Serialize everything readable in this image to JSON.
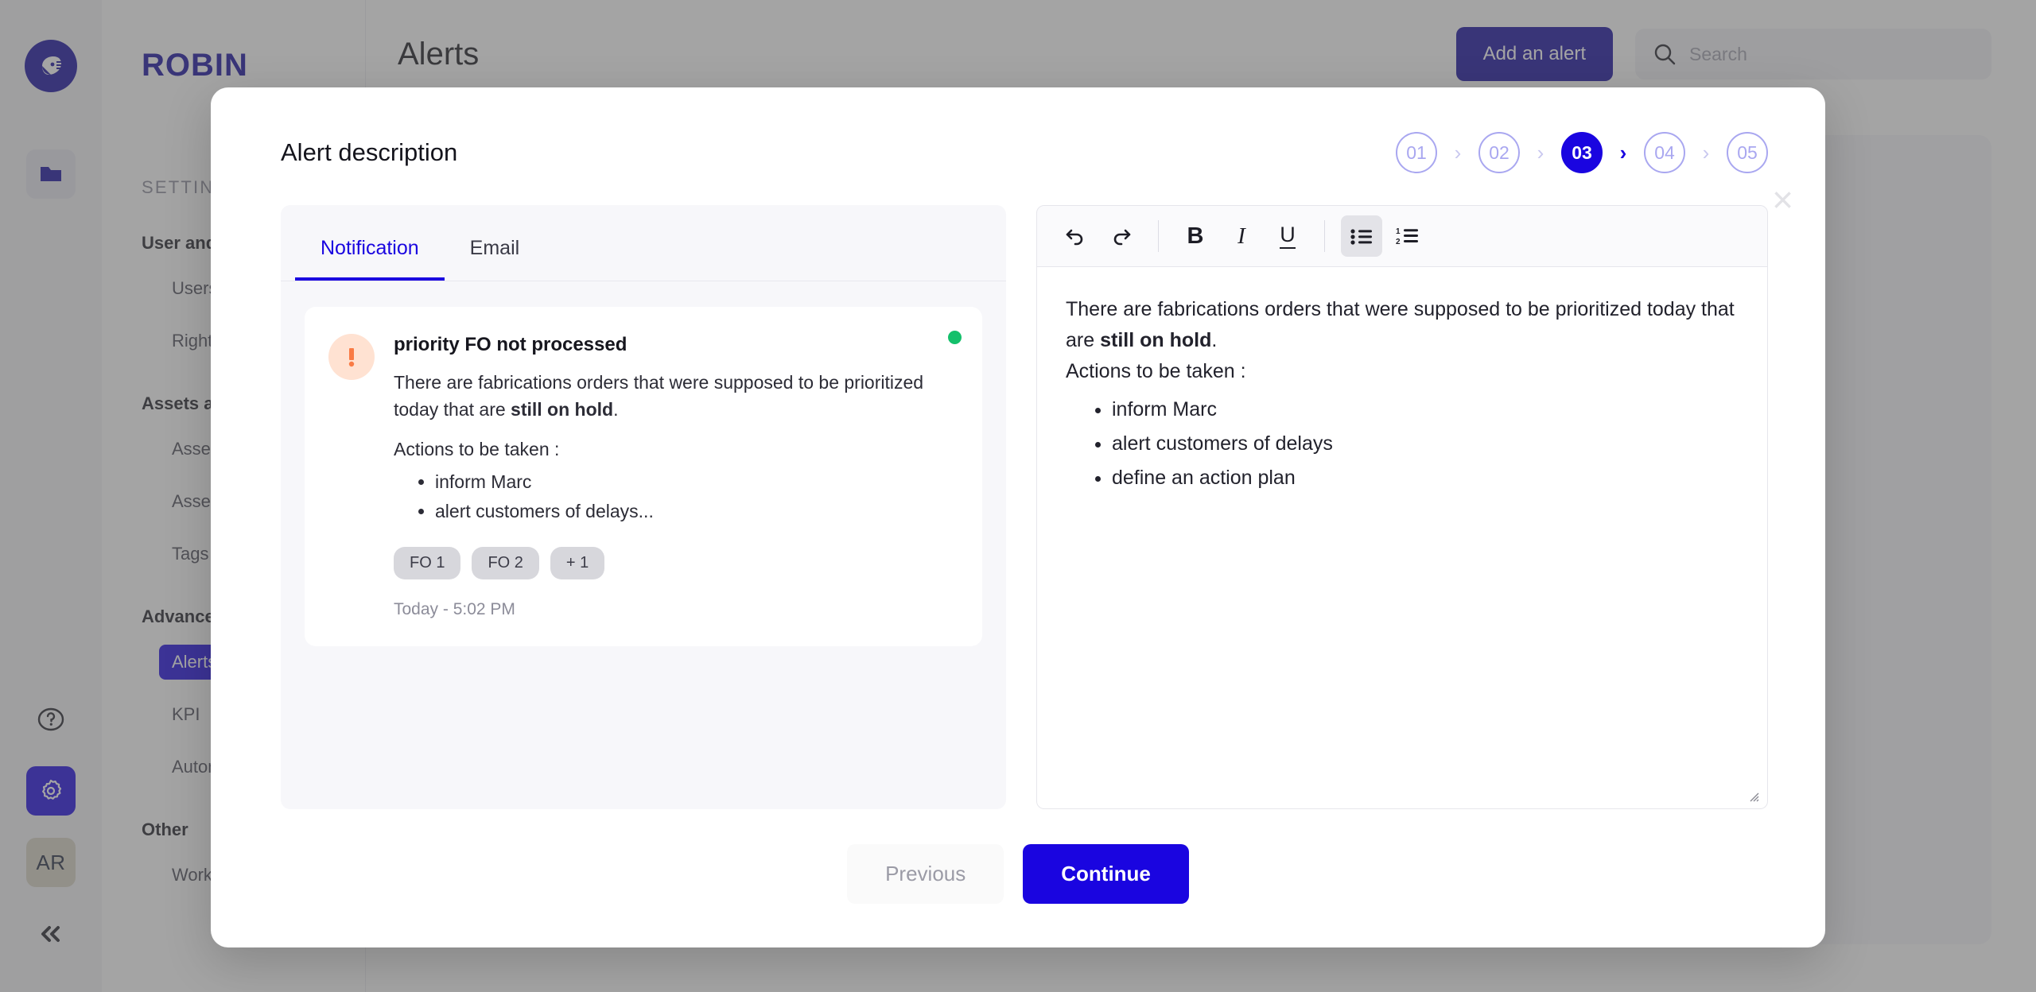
{
  "app": {
    "brand": "ROBIN",
    "avatar_initials": "AR",
    "page_title": "Alerts",
    "add_alert_label": "Add an alert",
    "search_placeholder": "Search",
    "settings_header": "SETTINGS",
    "nav_groups": [
      {
        "label": "User and rights",
        "items": [
          "Users",
          "Rights"
        ]
      },
      {
        "label": "Assets and tags",
        "items": [
          "Asset types",
          "Assets",
          "Tags"
        ]
      },
      {
        "label": "Advanced",
        "items": [
          "Alerts",
          "KPI",
          "Automation"
        ]
      },
      {
        "label": "Other",
        "items": [
          "Work hours"
        ]
      }
    ],
    "active_nav_item": "Alerts",
    "rail_icons": [
      "robin-logo",
      "folder-icon",
      "help-icon",
      "gear-icon",
      "avatar",
      "collapse-icon"
    ]
  },
  "modal": {
    "title": "Alert description",
    "close_label": "×",
    "steps": [
      {
        "label": "01",
        "active": false
      },
      {
        "label": "02",
        "active": false
      },
      {
        "label": "03",
        "active": true
      },
      {
        "label": "04",
        "active": false
      },
      {
        "label": "05",
        "active": false
      }
    ],
    "step_separator": "›",
    "tabs": [
      {
        "label": "Notification",
        "active": true
      },
      {
        "label": "Email",
        "active": false
      }
    ],
    "notification": {
      "icon": "alert-exclamation-icon",
      "title": "priority FO not processed",
      "text_before": "There are fabrications orders that were supposed to be prioritized today that are ",
      "text_bold": "still on hold",
      "text_after": ".",
      "actions_label": "Actions to be taken :",
      "actions": [
        "inform Marc",
        "alert customers of delays..."
      ],
      "chips": [
        "FO 1",
        "FO 2",
        "+ 1"
      ],
      "timestamp": "Today - 5:02 PM",
      "status_color": "#14c06b"
    },
    "editor": {
      "toolbar": [
        {
          "name": "undo-icon",
          "glyph": "↶",
          "active": false
        },
        {
          "name": "redo-icon",
          "glyph": "↷",
          "active": false
        },
        {
          "name": "bold-icon",
          "glyph": "B",
          "active": false
        },
        {
          "name": "italic-icon",
          "glyph": "I",
          "active": false
        },
        {
          "name": "underline-icon",
          "glyph": "U",
          "active": false
        },
        {
          "name": "bullet-list-icon",
          "glyph": "",
          "active": true
        },
        {
          "name": "numbered-list-icon",
          "glyph": "",
          "active": false
        }
      ],
      "text_before": "There are fabrications orders that were supposed to be prioritized today that are ",
      "text_bold": "still on hold",
      "text_after": ".",
      "actions_label": "Actions to be taken :",
      "actions": [
        "inform Marc",
        "alert customers of delays",
        "define an action plan"
      ]
    },
    "footer": {
      "previous_label": "Previous",
      "continue_label": "Continue"
    }
  },
  "colors": {
    "brand_blue": "#130a9e",
    "accent_blue": "#1a05e0",
    "step_inactive": "#a9a7f0",
    "alert_orange": "#f97b45",
    "status_green": "#14c06b"
  }
}
